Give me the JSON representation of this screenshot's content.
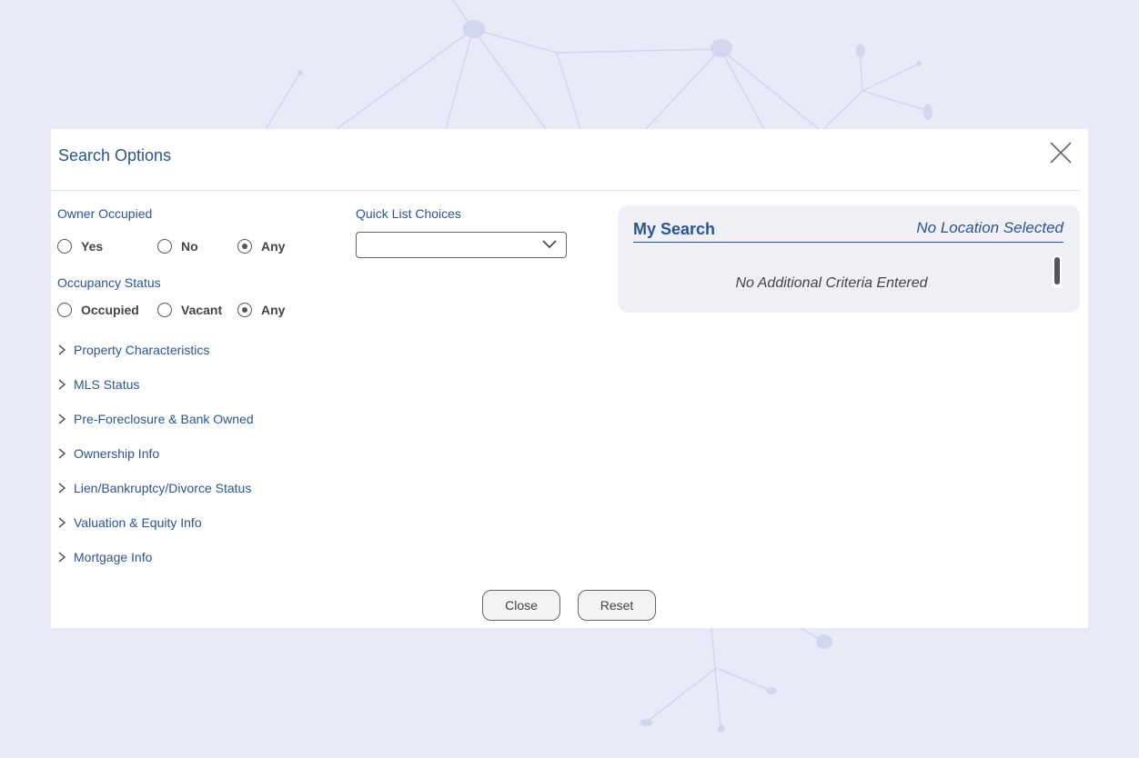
{
  "modal": {
    "title": "Search Options",
    "close_icon": "close-x-icon"
  },
  "owner_occupied": {
    "label": "Owner Occupied",
    "options": [
      "Yes",
      "No",
      "Any"
    ],
    "selected": "Any"
  },
  "occupancy_status": {
    "label": "Occupancy Status",
    "options": [
      "Occupied",
      "Vacant",
      "Any"
    ],
    "selected": "Any"
  },
  "quick_list": {
    "label": "Quick List Choices",
    "value": ""
  },
  "sections": [
    "Property Characteristics",
    "MLS Status",
    "Pre-Foreclosure & Bank Owned",
    "Ownership Info",
    "Lien/Bankruptcy/Divorce Status",
    "Valuation & Equity Info",
    "Mortgage Info"
  ],
  "my_search": {
    "title": "My Search",
    "location": "No Location Selected",
    "criteria": "No Additional Criteria Entered"
  },
  "buttons": {
    "close": "Close",
    "reset": "Reset"
  },
  "colors": {
    "background": "#e8eaf8",
    "accent": "#2a5592",
    "panel": "#eef0f6"
  }
}
